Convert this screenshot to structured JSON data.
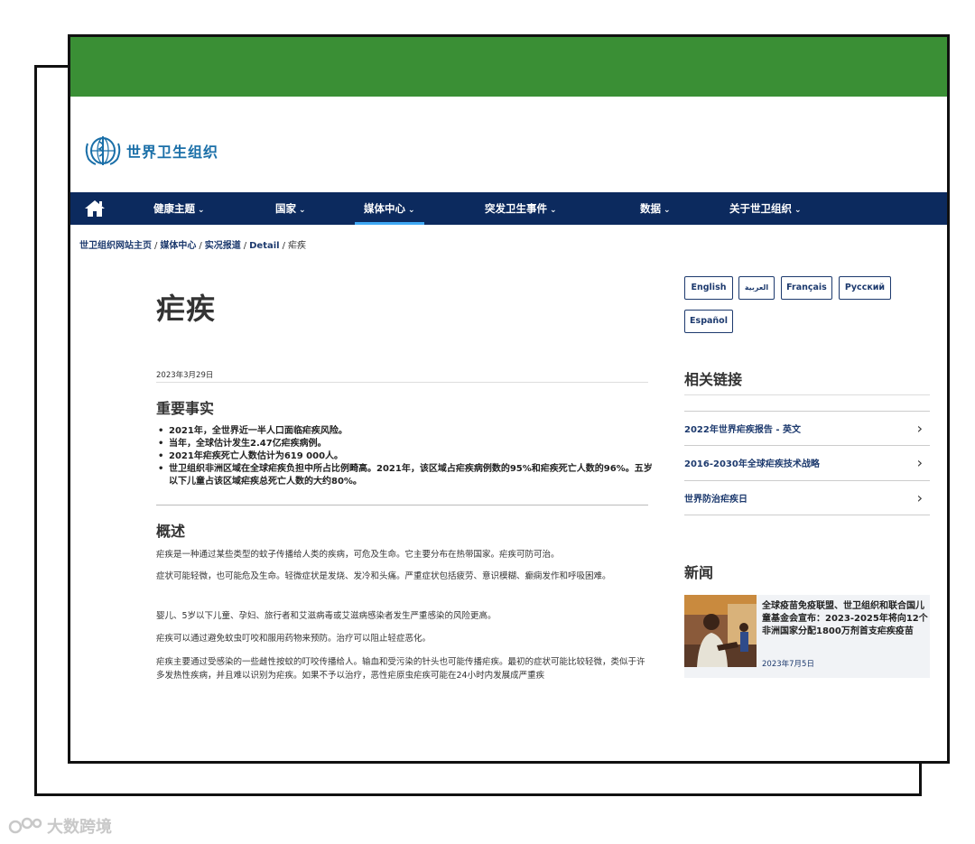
{
  "site": {
    "org_name": "世界卫生组织"
  },
  "nav": {
    "items": [
      {
        "label": "健康主题"
      },
      {
        "label": "国家"
      },
      {
        "label": "媒体中心"
      },
      {
        "label": "突发卫生事件"
      },
      {
        "label": "数据"
      },
      {
        "label": "关于世卫组织"
      }
    ],
    "active_index": 2,
    "chevron": "⌄"
  },
  "breadcrumb": {
    "items": [
      "世卫组织网站主页",
      "媒体中心",
      "实况报道",
      "Detail"
    ],
    "current": "疟疾",
    "separator": "/"
  },
  "article": {
    "title": "疟疾",
    "date": "2023年3月29日",
    "key_facts_heading": "重要事实",
    "key_facts": [
      "2021年，全世界近一半人口面临疟疾风险。",
      "当年，全球估计发生2.47亿疟疾病例。",
      "2021年疟疾死亡人数估计为619 000人。",
      "世卫组织非洲区域在全球疟疾负担中所占比例畸高。2021年，该区域占疟疾病例数的95%和疟疾死亡人数的96%。五岁以下儿童占该区域疟疾总死亡人数的大约80%。"
    ],
    "overview_heading": "概述",
    "paragraphs": [
      "疟疾是一种通过某些类型的蚊子传播给人类的疾病，可危及生命。它主要分布在热带国家。疟疾可防可治。",
      "症状可能轻微，也可能危及生命。轻微症状是发烧、发冷和头痛。严重症状包括疲劳、意识模糊、癫痫发作和呼吸困难。",
      "婴儿、5岁以下儿童、孕妇、旅行者和艾滋病毒或艾滋病感染者发生严重感染的风险更高。",
      "疟疾可以通过避免蚊虫叮咬和服用药物来预防。治疗可以阻止轻症恶化。",
      "疟疾主要通过受感染的一些雌性按蚊的叮咬传播给人。输血和受污染的针头也可能传播疟疾。最初的症状可能比较轻微，类似于许多发热性疾病，并且难以识别为疟疾。如果不予以治疗，恶性疟原虫疟疾可能在24小时内发展成严重疾"
    ]
  },
  "languages": [
    "English",
    "العربية",
    "Français",
    "Русский",
    "Español"
  ],
  "related": {
    "heading": "相关链接",
    "links": [
      {
        "label": "2022年世界疟疾报告 - 英文"
      },
      {
        "label": "2016-2030年全球疟疾技术战略"
      },
      {
        "label": "世界防治疟疾日"
      }
    ],
    "arrow": "›"
  },
  "news": {
    "heading": "新闻",
    "items": [
      {
        "title": "全球疫苗免疫联盟、世卫组织和联合国儿童基金会宣布：2023-2025年将向12个非洲国家分配1800万剂首支疟疾疫苗",
        "date": "2023年7月5日"
      }
    ]
  },
  "watermark": {
    "text": "大数跨境"
  },
  "colors": {
    "top_bar": "#3a8f35",
    "nav_bg": "#0c2a5e",
    "link": "#1d3a6e",
    "logo_text": "#1a6fa8"
  },
  "icons": {
    "nav_home": "home-icon",
    "logo": "who-emblem-icon",
    "link_arrow": "chevron-right-icon",
    "watermark": "watermark-logo-icon"
  }
}
